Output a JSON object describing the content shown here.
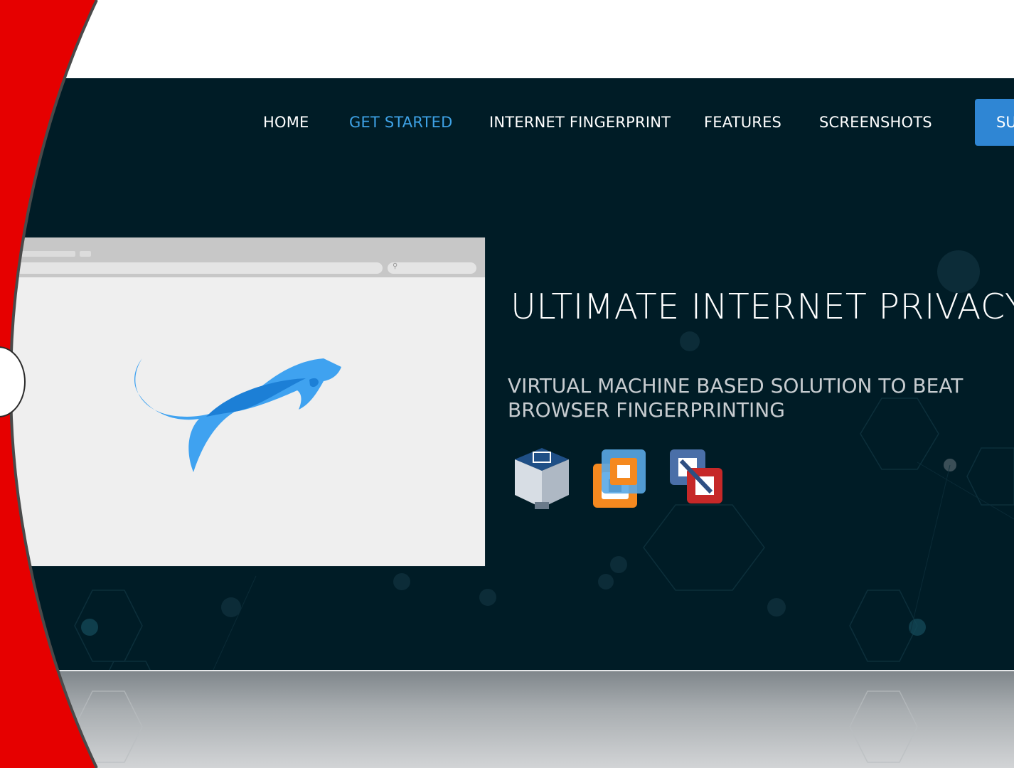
{
  "nav": {
    "items": [
      {
        "label": "HOME",
        "active": false
      },
      {
        "label": "GET STARTED",
        "active": true
      },
      {
        "label": "INTERNET FINGERPRINT",
        "active": false
      },
      {
        "label": "FEATURES",
        "active": false
      },
      {
        "label": "SCREENSHOTS",
        "active": false
      }
    ],
    "cta_label": "SU"
  },
  "hero": {
    "headline": "ULTIMATE INTERNET PRIVACY",
    "subheadline": "VIRTUAL MACHINE BASED SOLUTION TO BEAT BROWSER FINGERPRINTING",
    "vm_icons": [
      "virtualbox-icon",
      "vmware-icon",
      "parallels-icon"
    ]
  },
  "colors": {
    "hero_bg": "#001c26",
    "accent_blue": "#3ea2e6",
    "cta_bg": "#2f86d4",
    "frame_red": "#e60000",
    "logo_blue": "#3fa2f0"
  }
}
